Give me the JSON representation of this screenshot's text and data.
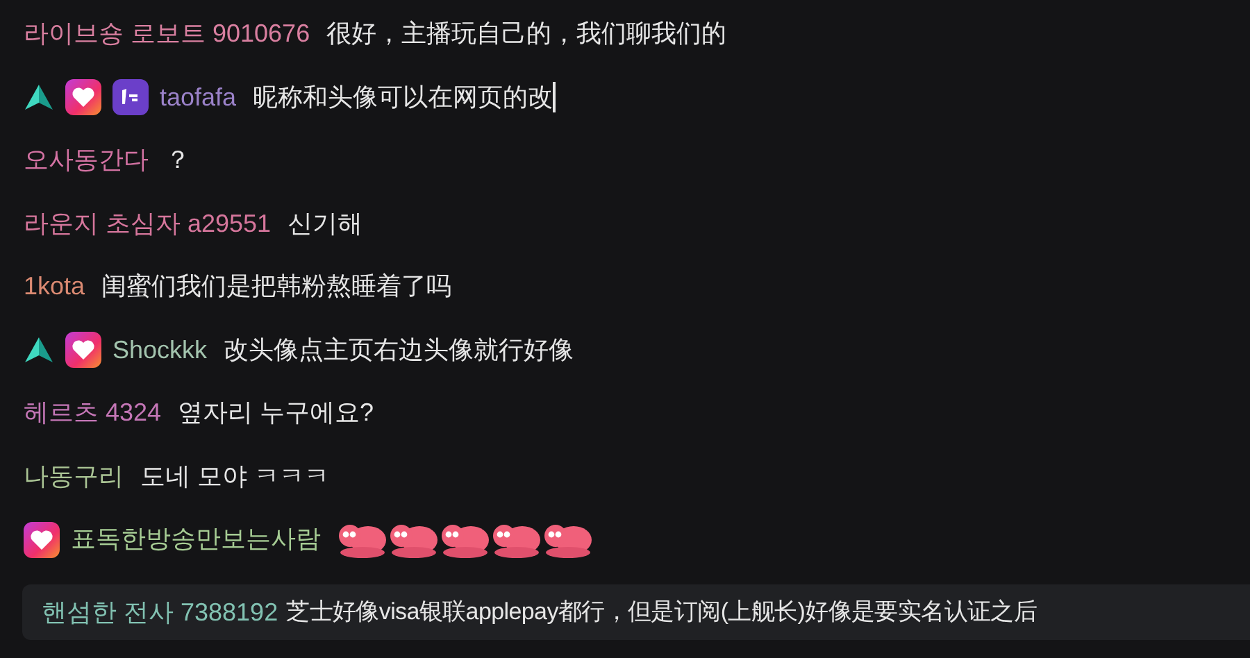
{
  "messages": [
    {
      "name": "라이브숑 로보트 9010676",
      "color": "#d97fa0",
      "text": "很好，主播玩自己的，我们聊我们的"
    },
    {
      "badges": [
        {
          "kind": "triangle"
        },
        {
          "kind": "heart"
        },
        {
          "kind": "first"
        }
      ],
      "name": "taofafa",
      "color": "#9b82c9",
      "text": "昵称和头像可以在网页的改",
      "caret": true
    },
    {
      "name": "오사동간다",
      "color": "#d573a4",
      "text": "？"
    },
    {
      "name": "라운지 초심자 a29551",
      "color": "#d6769c",
      "text": "신기해"
    },
    {
      "name": "1kota",
      "color": "#db8a72",
      "text": "闺蜜们我们是把韩粉熬睡着了吗"
    },
    {
      "badges": [
        {
          "kind": "triangle"
        },
        {
          "kind": "heart"
        }
      ],
      "name": "Shockkk",
      "color": "#a3c4ae",
      "text": "改头像点主页右边头像就行好像"
    },
    {
      "name": "헤르츠 4324",
      "color": "#c476b6",
      "text": "옆자리 누구에요?"
    },
    {
      "name": "나동구리",
      "color": "#abc595",
      "text": "도네 모야 ㅋㅋㅋ"
    },
    {
      "badges": [
        {
          "kind": "heart"
        }
      ],
      "name": "표독한방송만보는사람",
      "color": "#a6cc94",
      "emotes": [
        {
          "kind": "octopus"
        },
        {
          "kind": "octopus"
        },
        {
          "kind": "octopus"
        },
        {
          "kind": "octopus"
        },
        {
          "kind": "octopus"
        }
      ]
    }
  ],
  "pinned": {
    "name": "핸섬한 전사 7388192",
    "color": "#82c2b2",
    "text": "芝士好像visa银联applepay都行，但是订阅(上舰长)好像是要实名认证之后"
  }
}
